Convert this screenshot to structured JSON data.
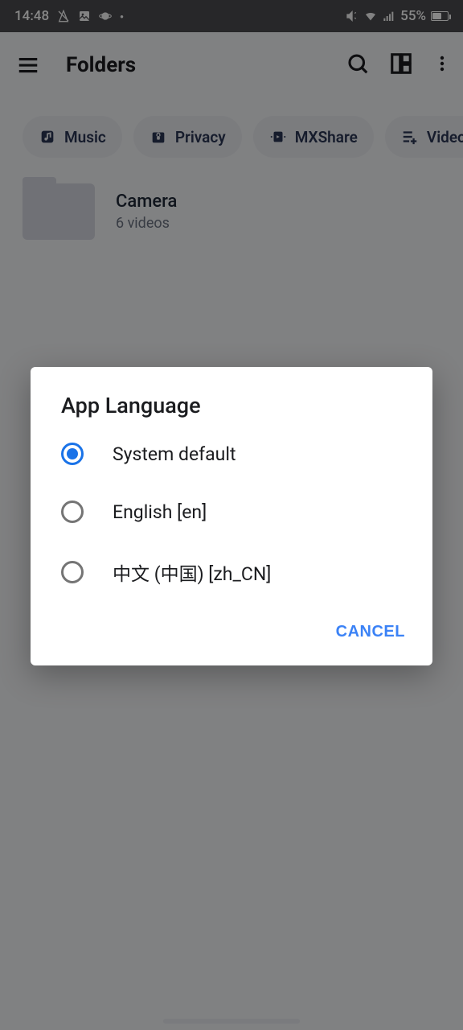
{
  "statusbar": {
    "time": "14:48",
    "battery": "55%"
  },
  "appbar": {
    "title": "Folders"
  },
  "chips": [
    {
      "label": "Music"
    },
    {
      "label": "Privacy"
    },
    {
      "label": "MXShare"
    },
    {
      "label": "Video"
    }
  ],
  "folder": {
    "name": "Camera",
    "subtitle": "6 videos"
  },
  "dialog": {
    "title": "App Language",
    "options": [
      {
        "label": "System default",
        "selected": true
      },
      {
        "label": "English [en]",
        "selected": false
      },
      {
        "label": "中文 (中国) [zh_CN]",
        "selected": false
      }
    ],
    "cancel": "CANCEL"
  }
}
